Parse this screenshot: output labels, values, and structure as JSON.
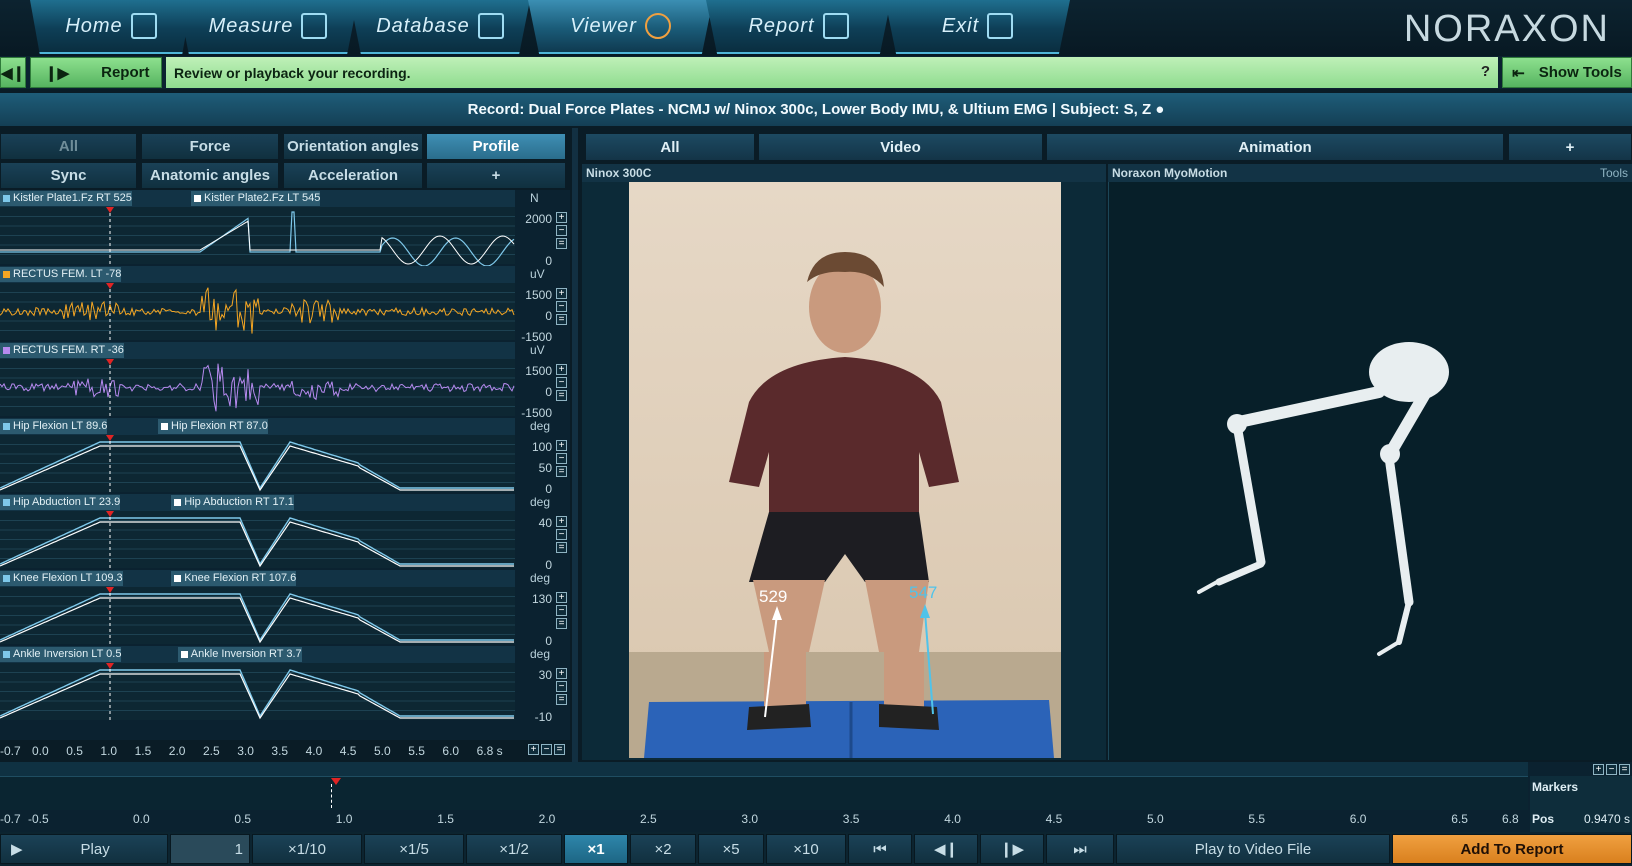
{
  "nav": {
    "tabs": [
      {
        "label": "Home",
        "icon": "home-icon"
      },
      {
        "label": "Measure",
        "icon": "measure-icon"
      },
      {
        "label": "Database",
        "icon": "database-icon"
      },
      {
        "label": "Viewer",
        "icon": "viewer-icon",
        "active": true
      },
      {
        "label": "Report",
        "icon": "report-icon"
      },
      {
        "label": "Exit",
        "icon": "exit-icon"
      }
    ],
    "logo": "NORAXON"
  },
  "toolbar": {
    "report_label": "Report",
    "message": "Review or playback your recording.",
    "help": "?",
    "show_tools_label": "Show Tools"
  },
  "record_title": "Record: Dual Force Plates - NCMJ w/ Ninox 300c, Lower Body IMU, & Ultium EMG | Subject: S, Z ●",
  "graph_tabs": {
    "row1": [
      "All",
      "Force",
      "Orientation angles",
      "Profile"
    ],
    "row2": [
      "Sync",
      "Anatomic angles",
      "Acceleration",
      "+"
    ],
    "active": "Profile"
  },
  "graphs": [
    {
      "labels": [
        "Kistler Plate1.Fz RT  525",
        "Kistler Plate2.Fz LT  545"
      ],
      "unit": "N",
      "ticks": [
        "2000",
        "0"
      ]
    },
    {
      "labels": [
        "RECTUS FEM. LT  -78"
      ],
      "unit": "uV",
      "ticks": [
        "1500",
        "0",
        "-1500"
      ]
    },
    {
      "labels": [
        "RECTUS FEM. RT  -36"
      ],
      "unit": "uV",
      "ticks": [
        "1500",
        "0",
        "-1500"
      ]
    },
    {
      "labels": [
        "Hip Flexion LT  89.6",
        "Hip Flexion RT  87.0"
      ],
      "unit": "deg",
      "ticks": [
        "100",
        "50",
        "0"
      ]
    },
    {
      "labels": [
        "Hip Abduction LT  23.9",
        "Hip Abduction RT  17.1"
      ],
      "unit": "deg",
      "ticks": [
        "40",
        "0"
      ]
    },
    {
      "labels": [
        "Knee Flexion LT  109.3",
        "Knee Flexion RT  107.6"
      ],
      "unit": "deg",
      "ticks": [
        "130",
        "0"
      ]
    },
    {
      "labels": [
        "Ankle Inversion LT  0.5",
        "Ankle Inversion RT  3.7"
      ],
      "unit": "deg",
      "ticks": [
        "30",
        "-10"
      ]
    }
  ],
  "graph_xaxis": [
    "-0.7",
    "0.0",
    "0.5",
    "1.0",
    "1.5",
    "2.0",
    "2.5",
    "3.0",
    "3.5",
    "4.0",
    "4.5",
    "5.0",
    "5.5",
    "6.0",
    "6.8 s"
  ],
  "media_tabs": [
    "All",
    "Video",
    "Animation",
    "+"
  ],
  "video_panel": {
    "title": "Ninox 300C",
    "force_left": "529",
    "force_right": "547"
  },
  "animation_panel": {
    "title": "Noraxon MyoMotion",
    "tools": "Tools"
  },
  "timeline": {
    "ticks": [
      "-0.7",
      "-0.5",
      "0.0",
      "0.5",
      "1.0",
      "1.5",
      "2.0",
      "2.5",
      "3.0",
      "3.5",
      "4.0",
      "4.5",
      "5.0",
      "5.5",
      "6.0",
      "6.5",
      "6.8"
    ],
    "markers_label": "Markers",
    "pos_label": "Pos",
    "pos_value": "0.9470 s"
  },
  "playbar": {
    "play": "Play",
    "frame": "1",
    "speeds": [
      "×1/10",
      "×1/5",
      "×1/2",
      "×1",
      "×2",
      "×5",
      "×10"
    ],
    "selected_speed": "×1",
    "play_to_video": "Play to Video File",
    "add_to_report": "Add To Report"
  },
  "colors": {
    "accent": "#2e86ab",
    "green": "#8de08e",
    "orange": "#f0a040",
    "emg_lt": "#f5a623",
    "emg_rt": "#b78af0",
    "trace_lt": "#7ec8ea",
    "trace_rt": "#ffffff"
  }
}
